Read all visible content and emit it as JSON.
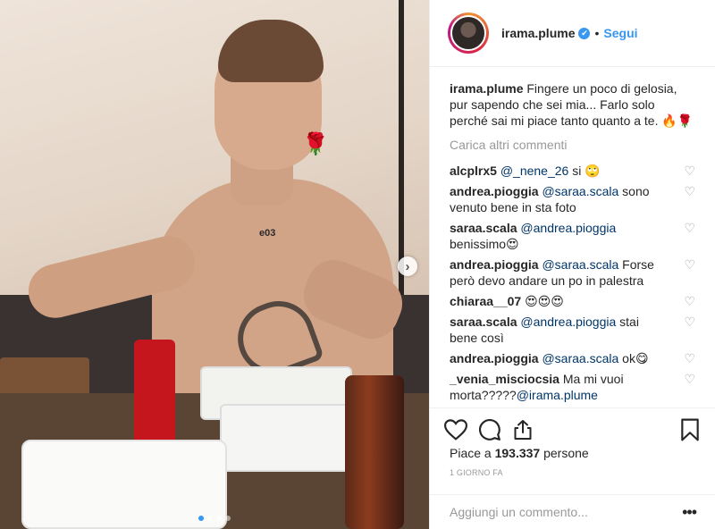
{
  "post": {
    "photo_alt": "",
    "carousel": {
      "next_label": "›",
      "dot_count": 4,
      "active_index": 0
    },
    "sticker": "🌹",
    "chest_tattoo": "e03"
  },
  "header": {
    "username": "irama.plume",
    "verified_mark": "✔",
    "separator": "•",
    "follow_label": "Segui"
  },
  "caption": {
    "username": "irama.plume",
    "text": "Fingere un poco di gelosia, pur sapendo che sei mia... Farlo solo perché sai mi piace tanto quanto a te. 🔥🌹"
  },
  "load_more_label": "Carica altri commenti",
  "comments": [
    {
      "username": "alcplrx5",
      "mention": "@_nene_26",
      "text": " si 🙄"
    },
    {
      "username": "andrea.pioggia",
      "mention": "@saraa.scala",
      "text": " sono venuto bene in sta foto"
    },
    {
      "username": "saraa.scala",
      "mention": "@andrea.pioggia",
      "text": " benissimo😍"
    },
    {
      "username": "andrea.pioggia",
      "mention": "@saraa.scala",
      "text": " Forse però devo andare un po in palestra"
    },
    {
      "username": "chiaraa__07",
      "mention": "",
      "text": "😍😍😍"
    },
    {
      "username": "saraa.scala",
      "mention": "@andrea.pioggia",
      "text": " stai bene così"
    },
    {
      "username": "andrea.pioggia",
      "mention": "@saraa.scala",
      "text": " ok😋"
    },
    {
      "username": "_venia_misciocsia",
      "mention": "",
      "text": "Ma mi vuoi morta?????",
      "mention_after": "@irama.plume"
    }
  ],
  "comment_like_icon": "♡",
  "actions": {
    "like_icon": "heart-icon",
    "comment_icon": "comment-icon",
    "share_icon": "share-icon",
    "save_icon": "bookmark-icon"
  },
  "likes": {
    "prefix": "Piace a ",
    "count": "193.337",
    "suffix": " persone"
  },
  "timestamp": "1 giorno fa",
  "add_comment": {
    "placeholder": "Aggiungi un commento...",
    "more_label": "•••"
  }
}
